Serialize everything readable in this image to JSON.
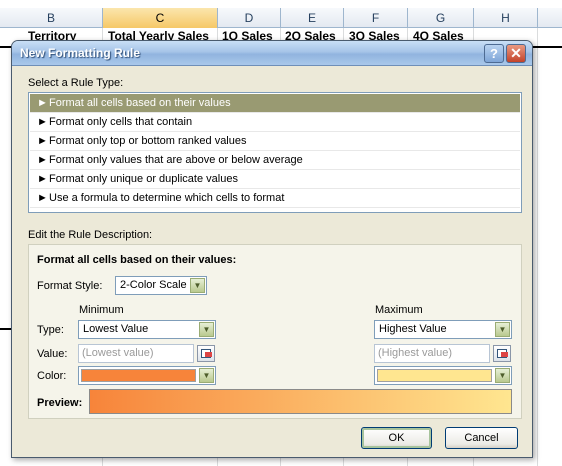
{
  "spreadsheet": {
    "columns": [
      "B",
      "C",
      "D",
      "E",
      "F",
      "G",
      "H"
    ],
    "selected_column": "C",
    "row1_cells": [
      "Territory",
      "Total Yearly Sales",
      "1Q Sales",
      "2Q Sales",
      "3Q Sales",
      "4Q Sales"
    ]
  },
  "dialog": {
    "title": "New Formatting Rule",
    "help_glyph": "?",
    "close_glyph": "✕",
    "select_rule_type_label": "Select a Rule Type:",
    "rule_types": [
      "Format all cells based on their values",
      "Format only cells that contain",
      "Format only top or bottom ranked values",
      "Format only values that are above or below average",
      "Format only unique or duplicate values",
      "Use a formula to determine which cells to format"
    ],
    "selected_rule_index": 0,
    "arrow_glyph": "►",
    "edit_rule_label": "Edit the Rule Description:",
    "description_title": "Format all cells based on their values:",
    "format_style_label": "Format Style:",
    "format_style_value": "2-Color Scale",
    "minimum_label": "Minimum",
    "maximum_label": "Maximum",
    "type_label": "Type:",
    "value_label": "Value:",
    "color_label": "Color:",
    "min_type": "Lowest Value",
    "max_type": "Highest Value",
    "min_value_placeholder": "(Lowest value)",
    "max_value_placeholder": "(Highest value)",
    "min_color": "#f7843a",
    "max_color": "#ffe690",
    "preview_label": "Preview:",
    "ok_label": "OK",
    "cancel_label": "Cancel"
  }
}
